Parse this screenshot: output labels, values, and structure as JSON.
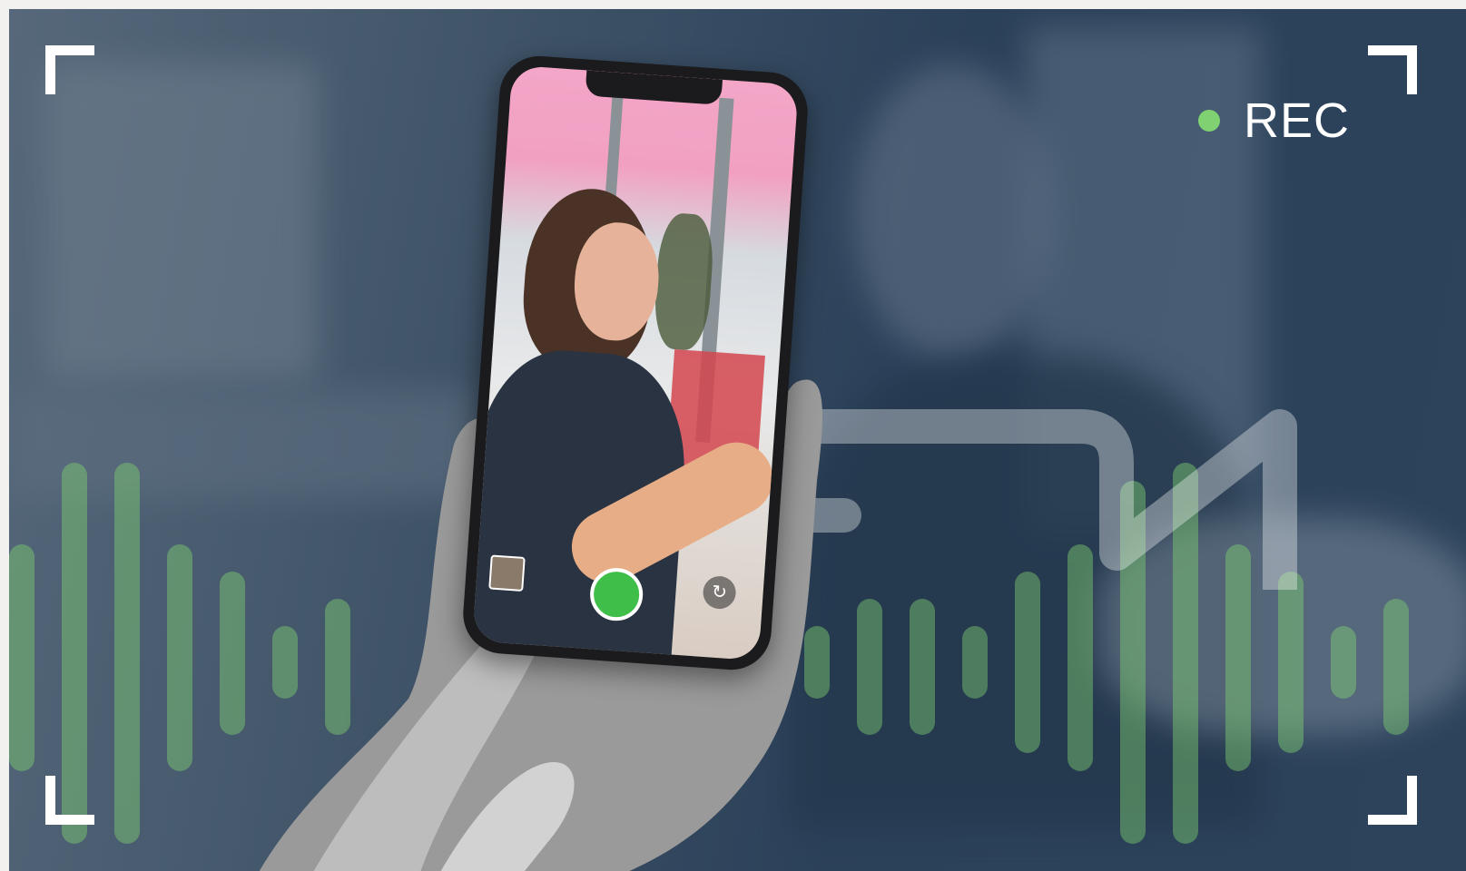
{
  "overlay": {
    "rec_label": "REC",
    "rec_dot_color": "#7fd171"
  },
  "icons": [
    "rec-dot-icon",
    "shutter-icon",
    "camera-flip-icon",
    "gallery-thumbnail-icon",
    "viewfinder-corner-icon"
  ],
  "colors": {
    "accent_green": "#7fd171",
    "background_navy": "#2b4159"
  }
}
